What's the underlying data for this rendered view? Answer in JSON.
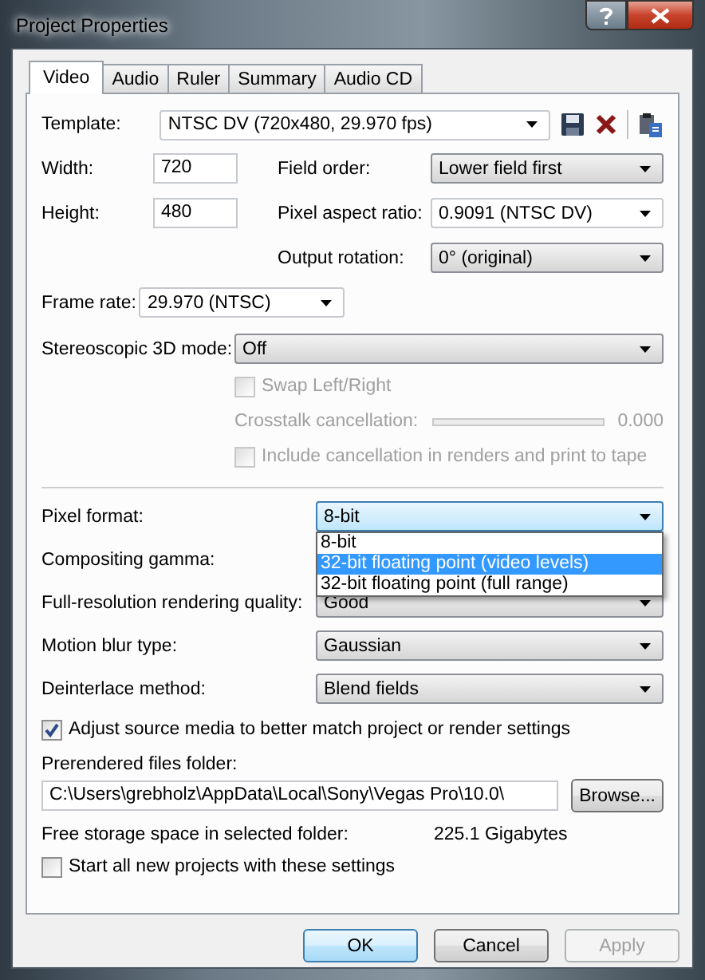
{
  "window": {
    "title": "Project Properties"
  },
  "tabs": [
    {
      "label": "Video",
      "selected": true
    },
    {
      "label": "Audio",
      "selected": false
    },
    {
      "label": "Ruler",
      "selected": false
    },
    {
      "label": "Summary",
      "selected": false
    },
    {
      "label": "Audio CD",
      "selected": false
    }
  ],
  "template": {
    "label": "Template:",
    "value": "NTSC DV (720x480, 29.970 fps)"
  },
  "width": {
    "label": "Width:",
    "value": "720"
  },
  "height": {
    "label": "Height:",
    "value": "480"
  },
  "field_order": {
    "label": "Field order:",
    "value": "Lower field first"
  },
  "pixel_aspect_ratio": {
    "label": "Pixel aspect ratio:",
    "value": "0.9091 (NTSC DV)"
  },
  "output_rotation": {
    "label": "Output rotation:",
    "value": "0° (original)"
  },
  "frame_rate": {
    "label": "Frame rate:",
    "value": "29.970 (NTSC)"
  },
  "stereoscopic": {
    "label": "Stereoscopic 3D mode:",
    "value": "Off"
  },
  "swap": {
    "label": "Swap Left/Right",
    "checked": false,
    "disabled": true
  },
  "crosstalk": {
    "label": "Crosstalk cancellation:",
    "level": 0,
    "reading": "0.000",
    "disabled": true
  },
  "include_cancellation": {
    "label": "Include cancellation in renders and print to tape",
    "checked": false,
    "disabled": true
  },
  "settings": [
    {
      "label": "Pixel format:",
      "value": "8-bit",
      "focused": true
    },
    {
      "label": "Compositing gamma:"
    },
    {
      "label": "Full-resolution rendering quality:",
      "value": "Good",
      "focused": false
    },
    {
      "label": "Motion blur type:",
      "value": "Gaussian",
      "focused": false
    },
    {
      "label": "Deinterlace method:",
      "value": "Blend fields",
      "focused": false
    }
  ],
  "dropdown": {
    "options": [
      {
        "label": "8-bit",
        "selected": false
      },
      {
        "label": "32-bit floating point (video levels)",
        "selected": true
      },
      {
        "label": "32-bit floating point (full range)",
        "selected": false
      }
    ]
  },
  "adjust_source": {
    "label": "Adjust source media to better match project or render settings",
    "checked": true,
    "disabled": false
  },
  "prerendered": {
    "label": "Prerendered files folder:",
    "value": "C:\\Users\\grebholz\\AppData\\Local\\Sony\\Vegas Pro\\10.0\\",
    "browse": "Browse..."
  },
  "free_space": {
    "label": "Free storage space in selected folder:",
    "value": "225.1 Gigabytes"
  },
  "start_all": {
    "label": "Start all new projects with these settings",
    "checked": false,
    "disabled": false
  },
  "buttons": [
    {
      "label": "OK",
      "default": true,
      "disabled": false
    },
    {
      "label": "Cancel",
      "default": false,
      "disabled": false
    },
    {
      "label": "Apply",
      "default": false,
      "disabled": true
    }
  ]
}
